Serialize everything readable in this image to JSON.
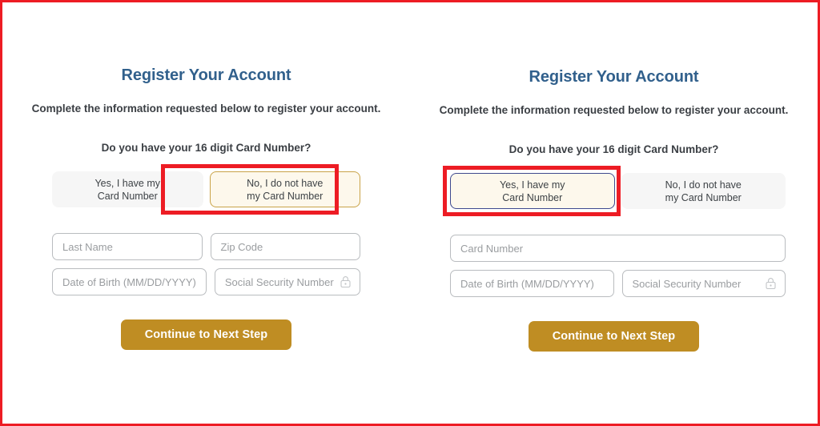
{
  "accent": {
    "title_blue": "#31608c",
    "annotation_red": "#ed1c24",
    "submit_gold": "#bf8d23",
    "selected_gold_border": "#c9a348",
    "selected_blue_border": "#3f4a8f",
    "selected_fill": "#fdf8ec",
    "unselected_fill": "#f6f6f6"
  },
  "panels": [
    {
      "id": "left",
      "title": "Register Your Account",
      "subtitle": "Complete the information requested below to register your account.",
      "question": "Do you have your 16 digit Card Number?",
      "choices": [
        {
          "id": "yes-have-card",
          "line1": "Yes, I have my",
          "line2": "Card Number",
          "state": "unselected",
          "annotated": false
        },
        {
          "id": "no-card",
          "line1": "No, I do not have",
          "line2": "my Card Number",
          "state": "selected",
          "annotated": true
        }
      ],
      "fields": [
        {
          "id": "last-name",
          "placeholder": "Last Name",
          "value": "",
          "lock": false
        },
        {
          "id": "zip-code",
          "placeholder": "Zip Code",
          "value": "",
          "lock": false
        },
        {
          "id": "date-of-birth",
          "placeholder": "Date of Birth (MM/DD/YYYY)",
          "value": "",
          "lock": false
        },
        {
          "id": "social-security-number",
          "placeholder": "Social Security Number",
          "value": "",
          "lock": true
        }
      ],
      "submit_label": "Continue to Next Step"
    },
    {
      "id": "right",
      "title": "Register Your Account",
      "subtitle": "Complete the information requested below to register your account.",
      "question": "Do you have your 16 digit Card Number?",
      "choices": [
        {
          "id": "yes-have-card",
          "line1": "Yes, I have my",
          "line2": "Card Number",
          "state": "selected",
          "annotated": true
        },
        {
          "id": "no-card",
          "line1": "No, I do not have",
          "line2": "my Card Number",
          "state": "unselected",
          "annotated": false
        }
      ],
      "fields": [
        {
          "id": "card-number",
          "placeholder": "Card Number",
          "value": "",
          "lock": false
        },
        {
          "id": "date-of-birth",
          "placeholder": "Date of Birth (MM/DD/YYYY)",
          "value": "",
          "lock": false
        },
        {
          "id": "social-security-number",
          "placeholder": "Social Security Number",
          "value": "",
          "lock": true
        }
      ],
      "submit_label": "Continue to Next Step"
    }
  ],
  "icons": {
    "lock": "lock-icon"
  }
}
